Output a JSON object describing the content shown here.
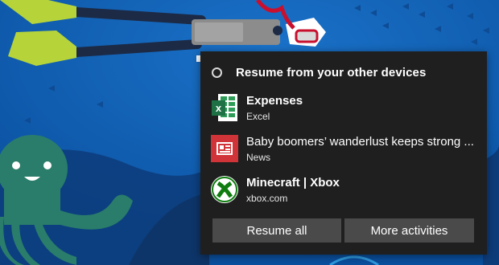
{
  "flyout": {
    "header": "Resume from your other devices",
    "items": [
      {
        "title": "Expenses",
        "subtitle": "Excel",
        "icon": "excel-icon",
        "accent": "#1e7145"
      },
      {
        "title": "Baby boomers’ wanderlust keeps strong ...",
        "subtitle": "News",
        "icon": "news-icon",
        "accent": "#d13438"
      },
      {
        "title": "Minecraft | Xbox",
        "subtitle": "xbox.com",
        "icon": "xbox-icon",
        "accent": "#107c10"
      }
    ],
    "buttons": {
      "resume_all": "Resume all",
      "more_activities": "More activities"
    }
  },
  "colors": {
    "flyout_bg": "#1f1f1f",
    "button_bg": "#4a4a4a",
    "wallpaper_bg": "#0c57a8"
  }
}
